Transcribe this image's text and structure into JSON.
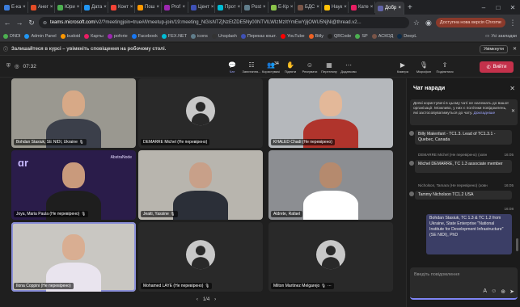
{
  "browser": {
    "tabs": [
      {
        "label": "Е-ка",
        "color": "#3b7ddd"
      },
      {
        "label": "Анег",
        "color": "#e34c26"
      },
      {
        "label": "Юри",
        "color": "#4caf50"
      },
      {
        "label": "Дата",
        "color": "#2196f3"
      },
      {
        "label": "Конт",
        "color": "#f44336"
      },
      {
        "label": "Пош",
        "color": "#ff9800"
      },
      {
        "label": "Prof",
        "color": "#9c27b0"
      },
      {
        "label": "Цент",
        "color": "#3f51b5"
      },
      {
        "label": "Прот",
        "color": "#00bcd4"
      },
      {
        "label": "Post",
        "color": "#607d8b"
      },
      {
        "label": "E-Кр",
        "color": "#8bc34a"
      },
      {
        "label": "БДС",
        "color": "#795548"
      },
      {
        "label": "Наук",
        "color": "#ffc107"
      },
      {
        "label": "Кате",
        "color": "#e91e63"
      },
      {
        "label": "Добр",
        "color": "#6264a7"
      }
    ],
    "active_tab_index": 14,
    "url_host": "teams.microsoft.com",
    "url_path": "/v2/?meetingjoin=true#/l/meetup-join/19:meeting_NGIsNTZjNzEtZDE5Ny00NTVlLWIzMzItYmEwYjljOWU5NjNi@thread.v2...",
    "update_button": "Доступна нова версія Chrome",
    "bookmarks": [
      "DNDI",
      "Admin Panel",
      "budoid",
      "Карты",
      "poforie",
      "Facebook",
      "FEX.NET",
      "icons",
      "Unsplash",
      "Переказ кошт.",
      "YouTube",
      "Bitly",
      "QRCode",
      "SP",
      "АСКОД",
      "DeepL"
    ],
    "bookmarks_right": "Усі закладки"
  },
  "notification": {
    "text": "Залишайтеся в курсі – увімкніть сповіщення на робочому столі.",
    "enable_button": "Увімкнути"
  },
  "meeting": {
    "timer": "07:32",
    "tools": [
      {
        "icon": "chat-icon",
        "glyph": "💬",
        "label": "Чат",
        "active": true
      },
      {
        "icon": "raise-hand-list-icon",
        "glyph": "☷",
        "label": "Запитання..."
      },
      {
        "icon": "people-icon",
        "glyph": "👥",
        "label": "Користувачі",
        "badge": "34"
      },
      {
        "icon": "hand-icon",
        "glyph": "✋",
        "label": "Підняти"
      },
      {
        "icon": "reactions-icon",
        "glyph": "☺",
        "label": "Реагувати"
      },
      {
        "icon": "view-icon",
        "glyph": "▦",
        "label": "Перегляну"
      },
      {
        "icon": "more-icon",
        "glyph": "⋯",
        "label": "Додатково"
      }
    ],
    "tools2": [
      {
        "icon": "camera-icon",
        "glyph": "▶",
        "label": "Камера"
      },
      {
        "icon": "mic-icon",
        "glyph": "🎙",
        "label": "Мікрофон"
      },
      {
        "icon": "share-icon",
        "glyph": "⇪",
        "label": "Поділитися"
      }
    ],
    "leave_label": "Вийти",
    "pager": {
      "text": "1/4"
    }
  },
  "participants": [
    {
      "name": "Bohdan Stasiuk, SE NIDI, Ukraine",
      "mic": "🎙",
      "type": "video",
      "bg": "#9a9890"
    },
    {
      "name": "DEMARRE Michel (Не перевірено)",
      "mic": "",
      "type": "avatar"
    },
    {
      "name": "KHALED Chadi (Не перевірено)",
      "mic": "",
      "type": "video",
      "bg": "#b5b8bc"
    },
    {
      "name": "Joya, Maria Paula (Не перевірено)",
      "mic": "🎙",
      "type": "video",
      "bg": "#2a1c4a",
      "brand": "AbstraNode"
    },
    {
      "name": "Jeaiti, Yassine",
      "mic": "🎙",
      "type": "video",
      "bg": "#b8b5ae"
    },
    {
      "name": "Aldrete, Rafael",
      "mic": "",
      "type": "video",
      "bg": "#8c8e92"
    },
    {
      "name": "Ilona Coppini (Не перевірено)",
      "mic": "",
      "type": "video",
      "bg": "#c9c7c2"
    },
    {
      "name": "Mohamed LAYE (Не перевірено)",
      "mic": "🎙",
      "type": "avatar"
    },
    {
      "name": "Milton Martinez Melgarejo",
      "mic": "🎙",
      "type": "avatar",
      "extra": "⋯"
    }
  ],
  "chat": {
    "title": "Чат наради",
    "notice": "Деякі користувачі в цьому чаті не належать до вашої організації. Можливо, у них є політики повідомлень, які застосовуватимуться до чату.",
    "notice_link": "Докладніше",
    "messages": [
      {
        "sender": "",
        "time": "",
        "text": "Billy Malenfant - TC1.3. Lead of TC1.3.1 - Quebec, Canada",
        "mine": false
      },
      {
        "sender": "DEMARRE Michel (Не перевірено) (зовн",
        "time": "16:05",
        "text": "Michel DEMARRE, TC 1.3 associate member",
        "mine": false
      },
      {
        "sender": "Nicholson, Tamara (Не перевірено) (зовн",
        "time": "16:05",
        "text": "Tammy Nicholson TC1.2 USA",
        "mine": false
      },
      {
        "sender": "",
        "time": "16:08",
        "text": "Bohdan Stasiuk, TC 1.3 & TC 1.2 from Ukraine, State Enterprise \"National Institute for Development Infrastructure\" (SE NIDI), PhD",
        "mine": true
      }
    ],
    "composer_placeholder": "Введіть повідомлення"
  }
}
